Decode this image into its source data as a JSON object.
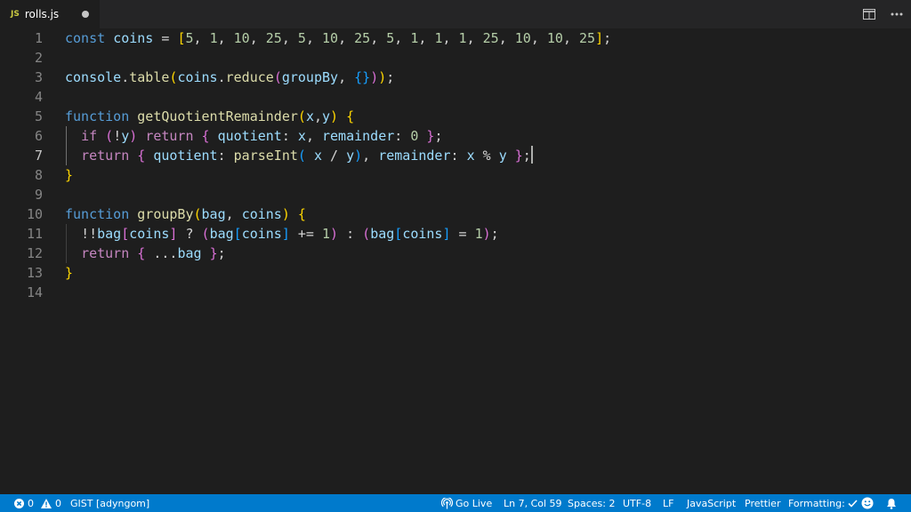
{
  "tab": {
    "icon_label": "JS",
    "filename": "rolls.js"
  },
  "icons": [
    "split-editor-icon",
    "more-actions-icon",
    "error-icon",
    "warning-icon",
    "broadcast-icon",
    "check-icon",
    "smiley-icon",
    "bell-icon"
  ],
  "line_numbers": [
    "1",
    "2",
    "3",
    "4",
    "5",
    "6",
    "7",
    "8",
    "9",
    "10",
    "11",
    "12",
    "13",
    "14"
  ],
  "active_line": "7",
  "code_lines": [
    "const coins = [5, 1, 10, 25, 5, 10, 25, 5, 1, 1, 1, 25, 10, 10, 25];",
    "",
    "console.table(coins.reduce(groupBy, {}));",
    "",
    "function getQuotientRemainder(x,y) {",
    "  if (!y) return { quotient: x, remainder: 0 };",
    "  return { quotient: parseInt( x / y), remainder: x % y };",
    "}",
    "",
    "function groupBy(bag, coins) {",
    "  !!bag[coins] ? (bag[coins] += 1) : (bag[coins] = 1);",
    "  return { ...bag };",
    "}",
    ""
  ],
  "status": {
    "errors": "0",
    "warnings": "0",
    "branch": "GIST [adyngom]",
    "go_live": "Go Live",
    "position": "Ln 7, Col 59",
    "spaces": "Spaces: 2",
    "encoding": "UTF-8",
    "eol": "LF",
    "language": "JavaScript",
    "prettier": "Prettier",
    "formatting": "Formatting:"
  },
  "colors": {
    "editor_bg": "#1e1e1e",
    "status_bg": "#007acc",
    "keyword": "#569cd6",
    "control": "#c586c0",
    "variable": "#9cdcfe",
    "function": "#dcdcaa",
    "number": "#b5cea8"
  }
}
